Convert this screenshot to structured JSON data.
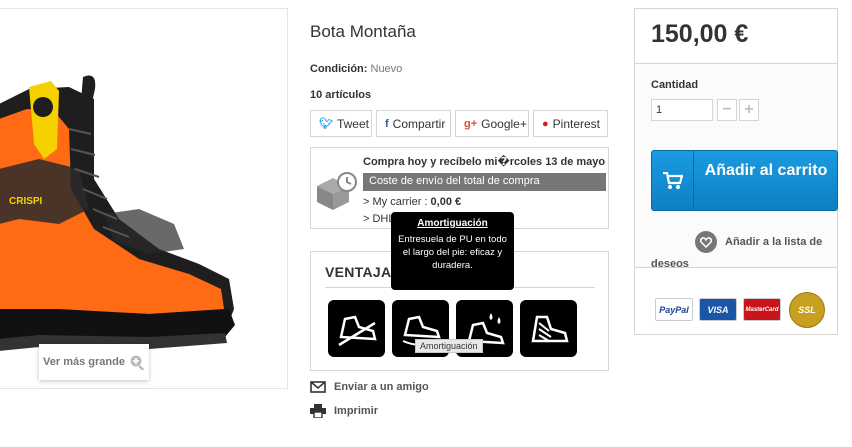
{
  "product": {
    "title": "Bota Montaña",
    "condition_label": "Condición:",
    "condition_value": "Nuevo",
    "stock": "10 artículos",
    "zoom_label": "Ver más grande"
  },
  "share": [
    {
      "label": "Tweet",
      "icon": "twitter-icon"
    },
    {
      "label": "Compartir",
      "icon": "facebook-icon"
    },
    {
      "label": "Google+",
      "icon": "google-plus-icon"
    },
    {
      "label": "Pinterest",
      "icon": "pinterest-icon"
    }
  ],
  "delivery": {
    "title": "Compra hoy y recíbelo mi�rcoles 13 de mayo",
    "bar": "Coste de envío del total de compra",
    "carrier_line_prefix": "> My carrier : ",
    "carrier_price": "0,00 €",
    "dhl_line": "> DHL"
  },
  "advantages": {
    "title": "VENTAJAS",
    "icons": [
      "sole-grip-icon",
      "cushioning-icon",
      "waterproof-icon",
      "lacing-icon"
    ]
  },
  "tooltip": {
    "title": "Amortiguación",
    "body": "Entresuela de PU en todo el largo del pie: eficaz y duradera.",
    "hover_label": "Amortiguación"
  },
  "links": {
    "send_friend": "Enviar a un amigo",
    "print": "Imprimir"
  },
  "buy": {
    "price": "150,00 €",
    "qty_label": "Cantidad",
    "qty_value": "1",
    "minus": "−",
    "plus": "+",
    "cart_label": "Añadir al carrito",
    "wishlist": "Añadir a la lista de deseos"
  },
  "payment": [
    "PayPal",
    "VISA",
    "MasterCard",
    "SSL"
  ],
  "colors": {
    "accent": "#1a9be0",
    "border": "#d6d4d4",
    "boot_orange": "#ff6a14",
    "boot_yellow": "#f5d100"
  }
}
